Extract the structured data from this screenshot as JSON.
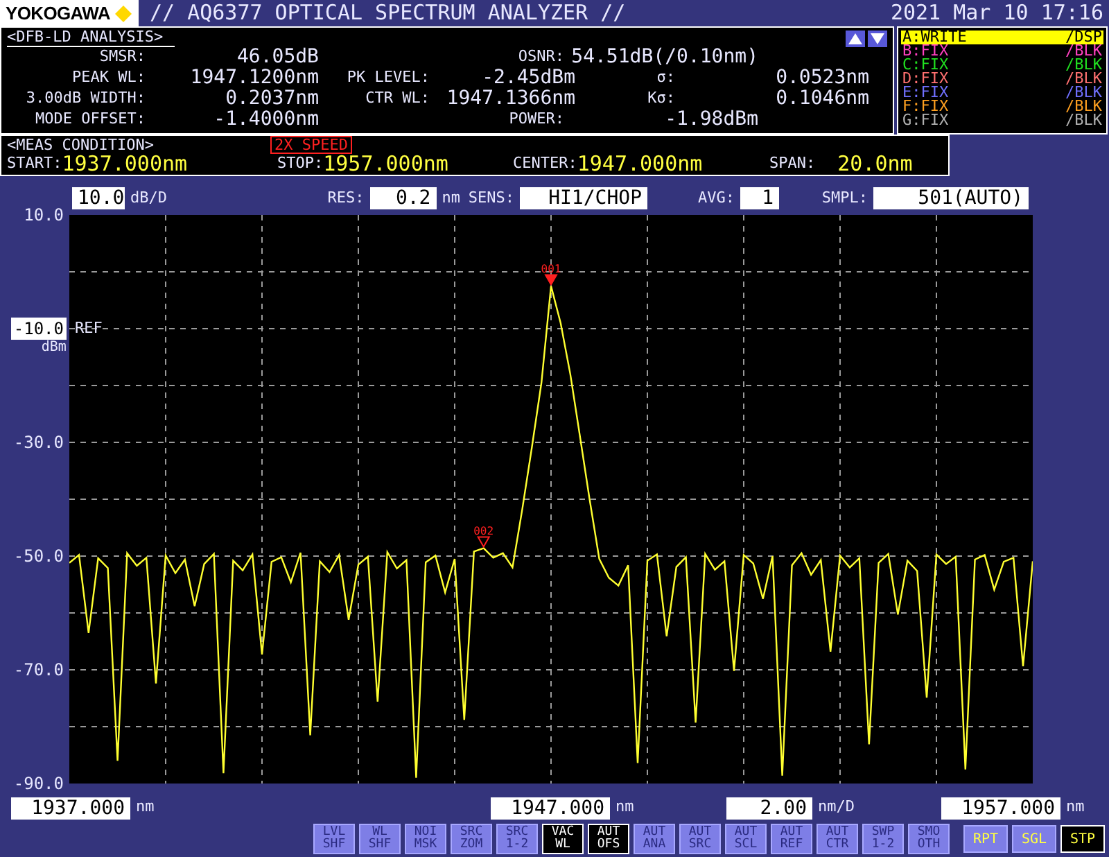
{
  "header": {
    "logo": "YOKOGAWA",
    "title": "// AQ6377 OPTICAL SPECTRUM ANALYZER //",
    "datetime": "2021 Mar 10 17:16"
  },
  "analysis": {
    "title": "<DFB-LD ANALYSIS>",
    "rows": [
      [
        {
          "label": "SMSR:",
          "value": "46.05dB"
        },
        null,
        {
          "label": "OSNR:",
          "value": "54.51dB(/0.10nm)"
        }
      ],
      [
        {
          "label": "PEAK WL:",
          "value": "1947.1200nm"
        },
        {
          "label": "PK LEVEL:",
          "value": "-2.45dBm"
        },
        {
          "label": "σ:",
          "value": "0.0523nm"
        }
      ],
      [
        {
          "label": "3.00dB WIDTH:",
          "value": "0.2037nm"
        },
        {
          "label": "CTR WL:",
          "value": "1947.1366nm"
        },
        {
          "label": "Kσ:",
          "value": "0.1046nm"
        }
      ],
      [
        {
          "label": "MODE OFFSET:",
          "value": "-1.4000nm"
        },
        null,
        {
          "label": "POWER:",
          "value": "-1.98dBm"
        }
      ]
    ]
  },
  "traces": [
    {
      "label": "A:WRITE",
      "mode": "/DSP",
      "color": "#ffff00",
      "selected": true
    },
    {
      "label": "B:FIX",
      "mode": "/BLK",
      "color": "#ff40c0",
      "selected": false
    },
    {
      "label": "C:FIX",
      "mode": "/BLK",
      "color": "#20e020",
      "selected": false
    },
    {
      "label": "D:FIX",
      "mode": "/BLK",
      "color": "#ff7070",
      "selected": false
    },
    {
      "label": "E:FIX",
      "mode": "/BLK",
      "color": "#7070ff",
      "selected": false
    },
    {
      "label": "F:FIX",
      "mode": "/BLK",
      "color": "#ffa020",
      "selected": false
    },
    {
      "label": "G:FIX",
      "mode": "/BLK",
      "color": "#b0b0b0",
      "selected": false
    }
  ],
  "meas": {
    "title": "<MEAS CONDITION>",
    "badge": "2X SPEED",
    "fields": [
      {
        "label": "START:",
        "value": "1937.000nm"
      },
      {
        "label": "STOP:",
        "value": "1957.000nm"
      },
      {
        "label": "CENTER:",
        "value": "1947.000nm"
      },
      {
        "label": "SPAN:",
        "value": "20.0nm"
      }
    ]
  },
  "settings": [
    {
      "value": "10.0",
      "unit": "dB/D"
    },
    {
      "label": "RES:",
      "value": "0.2",
      "unit": "nm"
    },
    {
      "label": "SENS:",
      "value": "HI1/CHOP"
    },
    {
      "label": "AVG:",
      "value": "1"
    },
    {
      "label": "SMPL:",
      "value": "501(AUTO)"
    }
  ],
  "plot": {
    "y_labels": [
      {
        "kind": "plain"
      },
      {
        "kind": "ref",
        "tag": "REF",
        "unit": "dBm"
      },
      {
        "kind": "plain"
      },
      {
        "kind": "plain"
      },
      {
        "kind": "plain"
      },
      {
        "kind": "plain"
      }
    ],
    "markers": [
      {
        "label": "001"
      },
      {
        "label": "002"
      }
    ],
    "chart_data": {
      "type": "line",
      "grid": true,
      "ylim": [
        -90,
        10
      ],
      "yticks": [
        {
          "value": 10,
          "label": "10.0"
        },
        {
          "value": -10,
          "label": "-10.0"
        },
        {
          "value": -30,
          "label": "-30.0"
        },
        {
          "value": -50,
          "label": "-50.0"
        },
        {
          "value": -70,
          "label": "-70.0"
        },
        {
          "value": -90,
          "label": "-90.0"
        }
      ],
      "series": [
        {
          "color": "#ffff30",
          "values": [
            -51.2,
            -49.8,
            -63.5,
            -50.4,
            -52.1,
            -86.0,
            -49.5,
            -51.7,
            -50.3,
            -72.4,
            -49.9,
            -53.0,
            -50.6,
            -58.8,
            -51.4,
            -49.6,
            -88.2,
            -50.8,
            -52.5,
            -49.7,
            -67.3,
            -51.0,
            -50.2,
            -54.6,
            -49.4,
            -81.5,
            -50.9,
            -52.8,
            -49.8,
            -61.2,
            -51.5,
            -50.1,
            -75.6,
            -49.3,
            -52.2,
            -50.7,
            -89.0,
            -51.1,
            -49.9,
            -56.4,
            -50.5,
            -78.8,
            -49.2,
            -48.6,
            -50.3,
            -49.5,
            -52.0,
            -42.0,
            -31.0,
            -19.5,
            -2.5,
            -9.0,
            -18.0,
            -29.0,
            -40.0,
            -50.5,
            -53.8,
            -55.2,
            -51.6,
            -86.4,
            -50.8,
            -49.7,
            -64.1,
            -51.9,
            -50.2,
            -79.3,
            -49.6,
            -52.4,
            -50.9,
            -70.2,
            -49.8,
            -51.3,
            -57.5,
            -50.0,
            -88.6,
            -51.6,
            -49.5,
            -53.3,
            -50.7,
            -66.8,
            -49.9,
            -52.0,
            -50.4,
            -83.1,
            -51.2,
            -49.6,
            -60.3,
            -50.8,
            -52.6,
            -74.9,
            -49.7,
            -51.4,
            -50.1,
            -87.5,
            -50.6,
            -49.8,
            -55.9,
            -51.0,
            -50.3,
            -69.4,
            -50.9
          ]
        }
      ]
    }
  },
  "x_axis": [
    {
      "value": "1937.000",
      "unit": "nm"
    },
    {
      "value": "1947.000",
      "unit": "nm"
    },
    {
      "value": "2.00",
      "unit": "nm/D"
    },
    {
      "value": "1957.000",
      "unit": "nm"
    }
  ],
  "soft_keys": [
    {
      "lines": [
        "LVL",
        "SHF"
      ],
      "selected": false
    },
    {
      "lines": [
        "WL",
        "SHF"
      ],
      "selected": false
    },
    {
      "lines": [
        "NOI",
        "MSK"
      ],
      "selected": false
    },
    {
      "lines": [
        "SRC",
        "ZOM"
      ],
      "selected": false
    },
    {
      "lines": [
        "SRC",
        "1-2"
      ],
      "selected": false
    },
    {
      "lines": [
        "VAC",
        "WL"
      ],
      "selected": true
    },
    {
      "lines": [
        "AUT",
        "OFS"
      ],
      "selected": true
    },
    {
      "lines": [
        "AUT",
        "ANA"
      ],
      "selected": false
    },
    {
      "lines": [
        "AUT",
        "SRC"
      ],
      "selected": false
    },
    {
      "lines": [
        "AUT",
        "SCL"
      ],
      "selected": false
    },
    {
      "lines": [
        "AUT",
        "REF"
      ],
      "selected": false
    },
    {
      "lines": [
        "AUT",
        "CTR"
      ],
      "selected": false
    },
    {
      "lines": [
        "SWP",
        "1-2"
      ],
      "selected": false
    },
    {
      "lines": [
        "SMO",
        "OTH"
      ],
      "selected": false
    }
  ],
  "run_keys": [
    {
      "label": "RPT",
      "selected": false
    },
    {
      "label": "SGL",
      "selected": false
    },
    {
      "label": "STP",
      "selected": true
    }
  ]
}
